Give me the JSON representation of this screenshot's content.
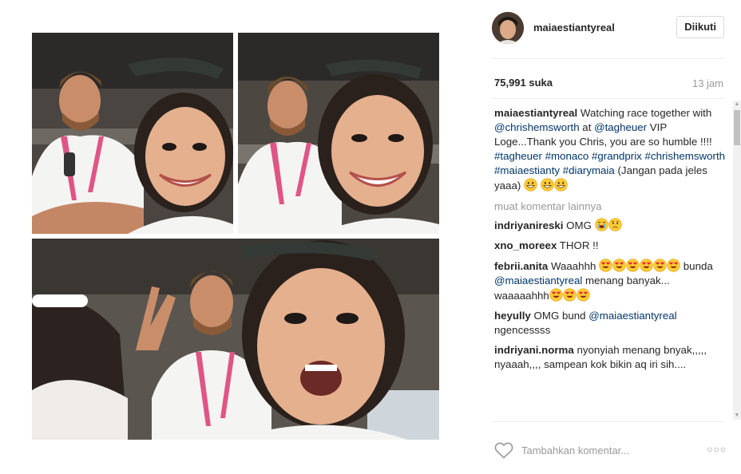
{
  "post": {
    "username": "maiaestiantyreal",
    "follow_label": "Diikuti",
    "likes": "75,991 suka",
    "time_ago": "13 jam"
  },
  "caption": {
    "username": "maiaestiantyreal",
    "text_1": " Watching race together with ",
    "mention_1": "@chrishemsworth",
    "text_2": " at ",
    "mention_2": "@tagheuer",
    "text_3": " VIP Loge...Thank you Chris, you are so humble !!!! ",
    "tags": [
      "#tagheuer",
      "#monaco",
      "#grandprix",
      "#chrishemsworth",
      "#maiaestianty",
      "#diarymaia"
    ],
    "text_4": " (Jangan pada jeles yaaa) "
  },
  "load_more": "muat komentar lainnya",
  "comments": [
    {
      "user": "indriyanireski",
      "text": " OMG "
    },
    {
      "user": "xno_moreex",
      "text": " THOR !!"
    },
    {
      "user": "febrii.anita",
      "text_1": " Waaahhh ",
      "text_2": " bunda ",
      "mention": "@maiaestiantyreal",
      "text_3": " menang banyak... waaaaahhh"
    },
    {
      "user": "heyully",
      "text_1": " OMG bund ",
      "mention": "@maiaestiantyreal",
      "text_2": " ngencessss"
    },
    {
      "user": "indriyani.norma",
      "text": " nyonyiah menang bnyak,,,,, nyaaah,,,, sampean kok bikin aq iri sih...."
    }
  ],
  "footer": {
    "comment_placeholder": "Tambahkan komentar...",
    "options_label": "○○○"
  },
  "icons": {
    "like": "heart-outline-icon",
    "options": "more-options-icon",
    "grin": "grinning-emoji-icon",
    "heart_eyes": "heart-eyes-emoji-icon",
    "crying": "crying-emoji-icon",
    "worried": "worried-emoji-icon"
  },
  "colors": {
    "link": "#003569",
    "muted": "#999999",
    "text": "#262626",
    "border": "#dbdbdb"
  }
}
